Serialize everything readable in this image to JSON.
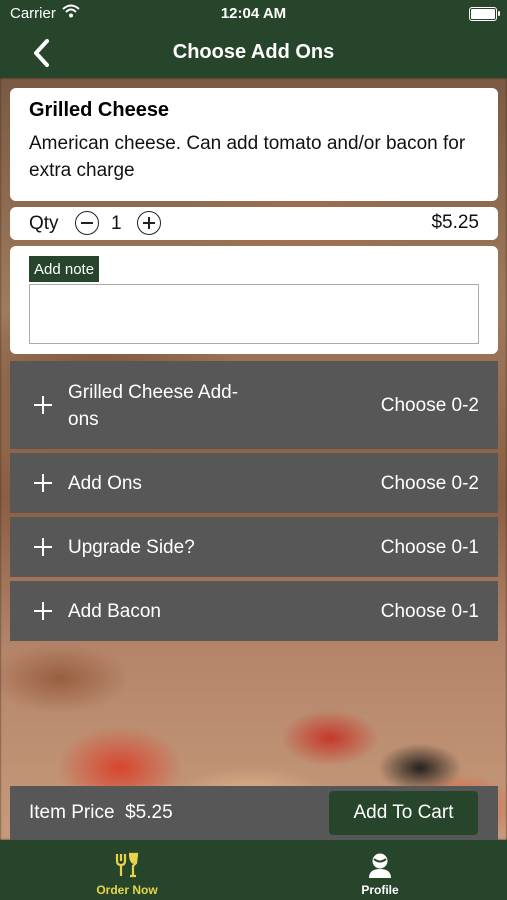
{
  "status_bar": {
    "carrier": "Carrier",
    "time": "12:04 AM"
  },
  "nav": {
    "title": "Choose Add Ons"
  },
  "item": {
    "name": "Grilled Cheese",
    "description": "American cheese. Can add tomato and/or bacon for extra charge"
  },
  "quantity": {
    "label": "Qty",
    "value": "1",
    "price": "$5.25"
  },
  "note": {
    "label": "Add note",
    "value": ""
  },
  "addons": [
    {
      "label": "Grilled Cheese Add-ons",
      "choose": "Choose 0-2"
    },
    {
      "label": "Add Ons",
      "choose": "Choose 0-2"
    },
    {
      "label": "Upgrade Side?",
      "choose": "Choose 0-1"
    },
    {
      "label": "Add Bacon",
      "choose": "Choose 0-1"
    }
  ],
  "footer": {
    "item_price_label": "Item Price",
    "item_price": "$5.25",
    "add_to_cart": "Add To Cart"
  },
  "tabs": [
    {
      "label": "Order Now",
      "icon": "fork-knife-icon",
      "active": true
    },
    {
      "label": "Profile",
      "icon": "person-icon",
      "active": false
    }
  ],
  "colors": {
    "brand_green": "#27452b",
    "addon_gray": "#575757",
    "active_tab": "#e8d44a"
  }
}
